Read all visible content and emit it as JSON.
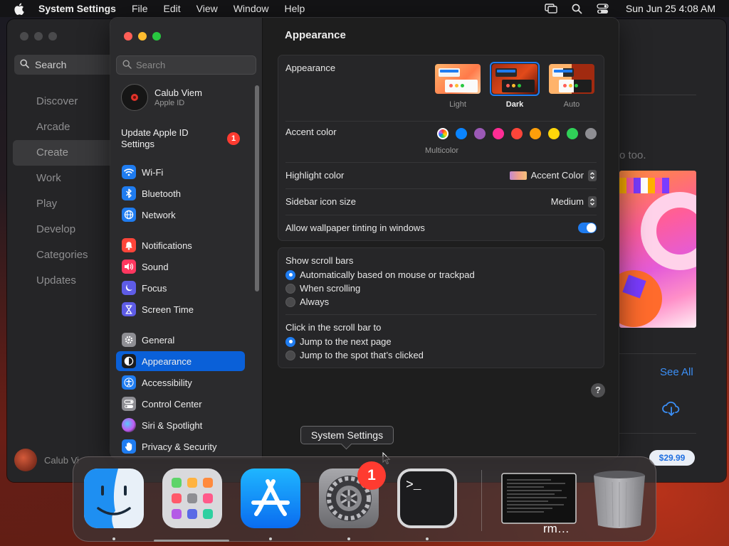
{
  "menubar": {
    "app_name": "System Settings",
    "items": [
      "File",
      "Edit",
      "View",
      "Window",
      "Help"
    ],
    "clock": "Sun Jun 25  4:08 AM"
  },
  "store": {
    "search_label": "Search",
    "nav": [
      "Discover",
      "Arcade",
      "Create",
      "Work",
      "Play",
      "Develop",
      "Categories",
      "Updates"
    ],
    "active_nav": "Create",
    "user": "Calub Vi",
    "subtext": "o too.",
    "see_all": "See All",
    "price": "$29.99"
  },
  "settings": {
    "search_placeholder": "Search",
    "account": {
      "name": "Calub Viem",
      "sub": "Apple ID"
    },
    "update": {
      "label": "Update Apple ID Settings",
      "badge": "1"
    },
    "sidebar_groups": [
      [
        {
          "label": "Wi-Fi",
          "icon": "wifi-icon",
          "color": "#1f7cf0"
        },
        {
          "label": "Bluetooth",
          "icon": "bluetooth-icon",
          "color": "#1f7cf0"
        },
        {
          "label": "Network",
          "icon": "globe-icon",
          "color": "#1f7cf0"
        }
      ],
      [
        {
          "label": "Notifications",
          "icon": "bell-icon",
          "color": "#ff453a"
        },
        {
          "label": "Sound",
          "icon": "speaker-icon",
          "color": "#ff375f"
        },
        {
          "label": "Focus",
          "icon": "moon-icon",
          "color": "#5e5ce6"
        },
        {
          "label": "Screen Time",
          "icon": "hourglass-icon",
          "color": "#5e5ce6"
        }
      ],
      [
        {
          "label": "General",
          "icon": "gear-icon",
          "color": "#8e8e93"
        },
        {
          "label": "Appearance",
          "icon": "appearance-icon",
          "color": "#1c1c1e"
        },
        {
          "label": "Accessibility",
          "icon": "accessibility-icon",
          "color": "#1f7cf0"
        },
        {
          "label": "Control Center",
          "icon": "control-center-icon",
          "color": "#8e8e93"
        },
        {
          "label": "Siri & Spotlight",
          "icon": "siri-icon",
          "color": "#bf5af2"
        },
        {
          "label": "Privacy & Security",
          "icon": "hand-icon",
          "color": "#1f7cf0"
        }
      ]
    ],
    "selected_item": "Appearance",
    "page_title": "Appearance",
    "appearance": {
      "label": "Appearance",
      "options": [
        "Light",
        "Dark",
        "Auto"
      ],
      "selected": "Dark"
    },
    "accent": {
      "label": "Accent color",
      "multicolor_label": "Multicolor",
      "colors": [
        "#0a84ff",
        "#9b59b6",
        "#ff2d95",
        "#ff453a",
        "#ff9f0a",
        "#ffd60a",
        "#30d158",
        "#8e8e93"
      ]
    },
    "highlight": {
      "label": "Highlight color",
      "value": "Accent Color"
    },
    "icon_size": {
      "label": "Sidebar icon size",
      "value": "Medium"
    },
    "tinting": {
      "label": "Allow wallpaper tinting in windows",
      "on": true
    },
    "scroll_bars": {
      "label": "Show scroll bars",
      "options": [
        "Automatically based on mouse or trackpad",
        "When scrolling",
        "Always"
      ],
      "selected": 0
    },
    "click_scroll": {
      "label": "Click in the scroll bar to",
      "options": [
        "Jump to the next page",
        "Jump to the spot that’s clicked"
      ],
      "selected": 0
    },
    "help": "?"
  },
  "tooltip": "System Settings",
  "dock": {
    "settings_badge": "1",
    "rm_label": "rm…"
  }
}
